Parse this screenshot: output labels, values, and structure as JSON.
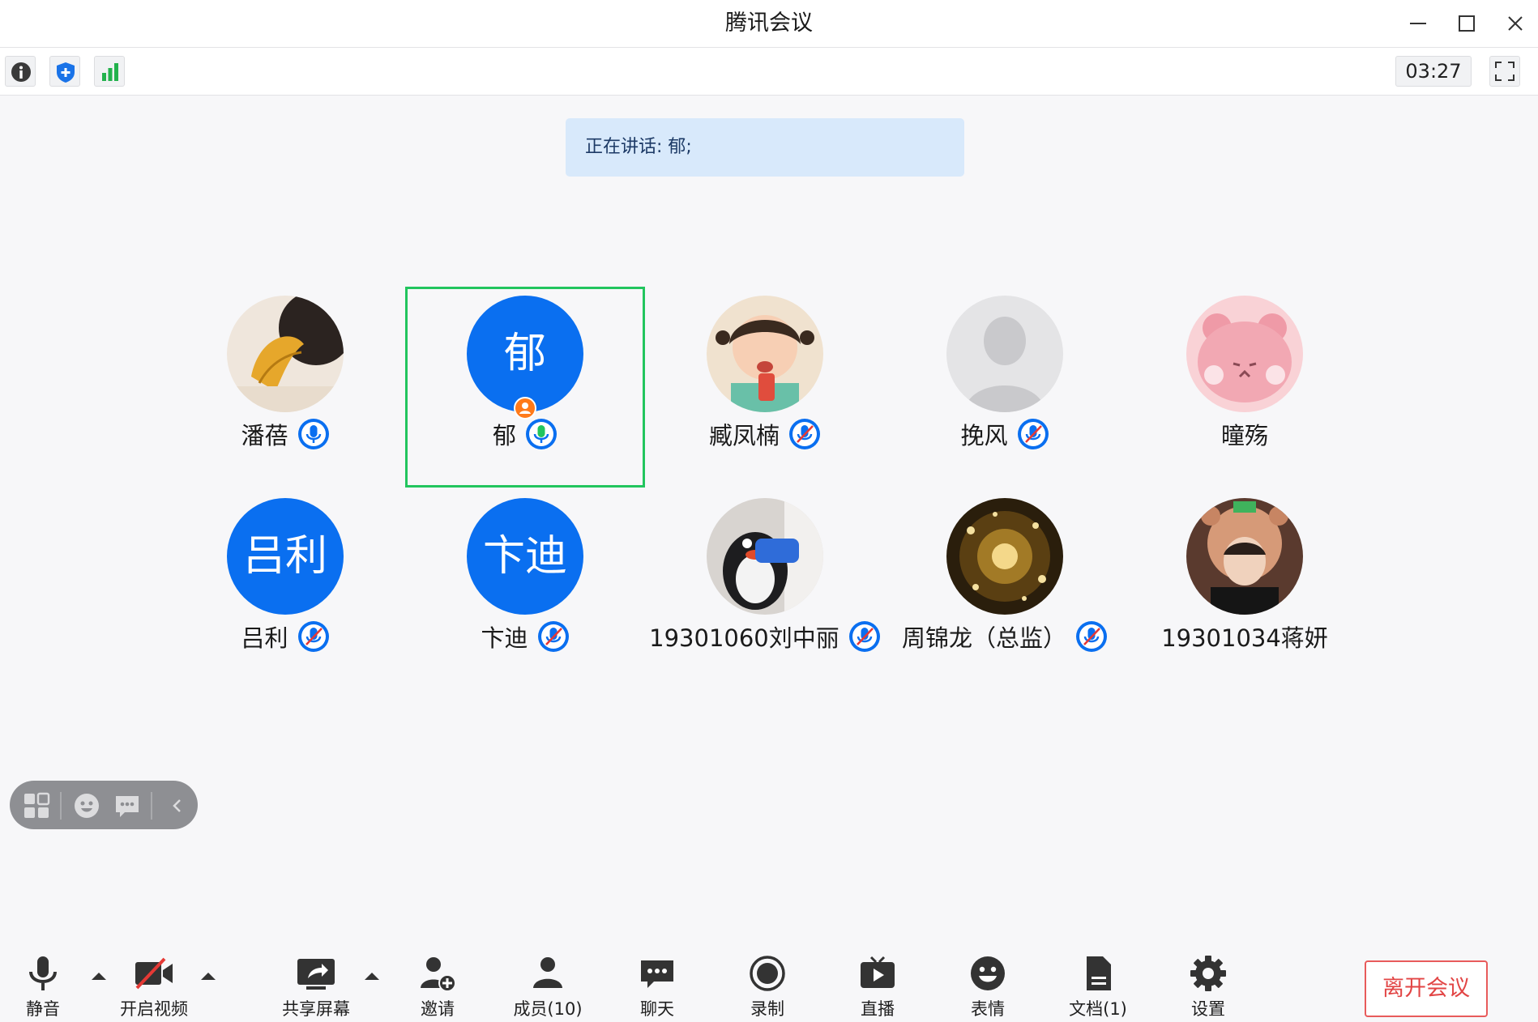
{
  "window": {
    "title": "腾讯会议",
    "controls": [
      "minimize-icon",
      "maximize-icon",
      "close-icon"
    ]
  },
  "infobar": {
    "buttons": [
      "info-icon",
      "shield-icon",
      "signal-icon"
    ],
    "timer": "03:27",
    "fullscreen_icon": "fullscreen-icon"
  },
  "speaking": {
    "text": "正在讲话: 郁;"
  },
  "participants": [
    {
      "name": "潘蓓",
      "avatar": "photo",
      "mic": "on"
    },
    {
      "name": "郁",
      "avatar_text": "郁",
      "mic": "speaking",
      "host": true,
      "active_speaker": true
    },
    {
      "name": "臧凤楠",
      "avatar": "photo",
      "mic": "muted"
    },
    {
      "name": "挽风",
      "avatar": "default-silhouette",
      "mic": "muted"
    },
    {
      "name": "曈殇",
      "avatar": "photo",
      "mic": "none"
    },
    {
      "name": "吕利",
      "avatar_text": "吕利",
      "mic": "muted"
    },
    {
      "name": "卞迪",
      "avatar_text": "卞迪",
      "mic": "muted"
    },
    {
      "name": "19301060刘中丽",
      "avatar": "photo",
      "mic": "muted"
    },
    {
      "name": "周锦龙（总监）",
      "avatar": "photo",
      "mic": "muted"
    },
    {
      "name": "19301034蒋妍",
      "avatar": "photo",
      "mic": "none"
    }
  ],
  "floating_toolbar": [
    "layout-icon",
    "emoji-icon",
    "chat-bubble-icon",
    "collapse-chevron-icon"
  ],
  "toolbar": {
    "mute": "静音",
    "video": "开启视频",
    "share": "共享屏幕",
    "invite": "邀请",
    "members": "成员(10)",
    "chat": "聊天",
    "record": "录制",
    "live": "直播",
    "reactions": "表情",
    "docs": "文档(1)",
    "settings": "设置",
    "leave": "离开会议"
  },
  "colors": {
    "accent": "#0a6ff0",
    "highlight_border": "#22c55e",
    "leave_red": "#e24545",
    "speaking_bg": "#d8e9fb"
  }
}
